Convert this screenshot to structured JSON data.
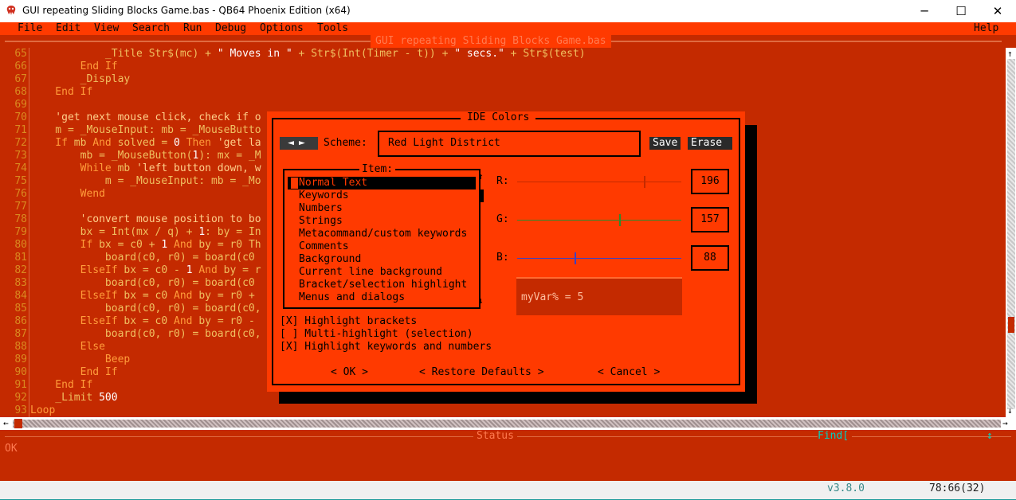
{
  "window": {
    "title": "GUI repeating Sliding Blocks Game.bas - QB64 Phoenix Edition (x64)",
    "minimize": "─",
    "maximize": "☐",
    "close": "✕"
  },
  "menu": {
    "file": "File",
    "edit": "Edit",
    "view": "View",
    "search": "Search",
    "run": "Run",
    "debug": "Debug",
    "options": "Options",
    "tools": "Tools",
    "help": "Help"
  },
  "editor": {
    "filename": "GUI repeating Sliding Blocks Game.bas",
    "line_numbers": [
      "65",
      "66",
      "67",
      "68",
      "69",
      "70",
      "71",
      "72",
      "73",
      "74",
      "75",
      "76",
      "77",
      "78",
      "79",
      "80",
      "81",
      "82",
      "83",
      "84",
      "85",
      "86",
      "87",
      "88",
      "89",
      "90",
      "91",
      "92",
      "93"
    ],
    "lines": [
      [
        {
          "c": "t",
          "s": "            _Title Str$(mc) + "
        },
        {
          "c": "n",
          "s": "\" Moves in \""
        },
        {
          "c": "t",
          "s": " + Str$(Int(Timer - t)) + "
        },
        {
          "c": "n",
          "s": "\" secs.\""
        },
        {
          "c": "t",
          "s": " + Str$(test)"
        }
      ],
      [
        {
          "c": "k",
          "s": "        End If"
        }
      ],
      [
        {
          "c": "t",
          "s": "        _Display"
        }
      ],
      [
        {
          "c": "k",
          "s": "    End If"
        }
      ],
      [
        {
          "c": "t",
          "s": ""
        }
      ],
      [
        {
          "c": "cm",
          "s": "    'get next mouse click, check if o"
        }
      ],
      [
        {
          "c": "t",
          "s": "    m = _MouseInput: mb = _MouseButto"
        }
      ],
      [
        {
          "c": "k",
          "s": "    If "
        },
        {
          "c": "t",
          "s": "mb "
        },
        {
          "c": "k",
          "s": "And "
        },
        {
          "c": "t",
          "s": "solved = "
        },
        {
          "c": "n",
          "s": "0"
        },
        {
          "c": "k",
          "s": " Then "
        },
        {
          "c": "cm",
          "s": "'get la"
        }
      ],
      [
        {
          "c": "t",
          "s": "        mb = _MouseButton("
        },
        {
          "c": "n",
          "s": "1"
        },
        {
          "c": "t",
          "s": "): mx = _M"
        }
      ],
      [
        {
          "c": "k",
          "s": "        While "
        },
        {
          "c": "t",
          "s": "mb "
        },
        {
          "c": "cm",
          "s": "'left button down, w"
        }
      ],
      [
        {
          "c": "t",
          "s": "            m = _MouseInput: mb = _Mo"
        }
      ],
      [
        {
          "c": "k",
          "s": "        Wend"
        }
      ],
      [
        {
          "c": "t",
          "s": ""
        }
      ],
      [
        {
          "c": "cm",
          "s": "        'convert mouse position to bo"
        }
      ],
      [
        {
          "c": "t",
          "s": "        bx = Int(mx / q) + "
        },
        {
          "c": "n",
          "s": "1"
        },
        {
          "c": "t",
          "s": ": by = In"
        }
      ],
      [
        {
          "c": "k",
          "s": "        If "
        },
        {
          "c": "t",
          "s": "bx = c0 + "
        },
        {
          "c": "n",
          "s": "1"
        },
        {
          "c": "k",
          "s": " And "
        },
        {
          "c": "t",
          "s": "by = r0 Th"
        }
      ],
      [
        {
          "c": "t",
          "s": "            board(c0, r0) = board(c0"
        }
      ],
      [
        {
          "c": "k",
          "s": "        ElseIf "
        },
        {
          "c": "t",
          "s": "bx = c0 - "
        },
        {
          "c": "n",
          "s": "1"
        },
        {
          "c": "k",
          "s": " And "
        },
        {
          "c": "t",
          "s": "by = r"
        }
      ],
      [
        {
          "c": "t",
          "s": "            board(c0, r0) = board(c0"
        }
      ],
      [
        {
          "c": "k",
          "s": "        ElseIf "
        },
        {
          "c": "t",
          "s": "bx = c0 "
        },
        {
          "c": "k",
          "s": "And "
        },
        {
          "c": "t",
          "s": "by = r0 +"
        }
      ],
      [
        {
          "c": "t",
          "s": "            board(c0, r0) = board(c0,"
        }
      ],
      [
        {
          "c": "k",
          "s": "        ElseIf "
        },
        {
          "c": "t",
          "s": "bx = c0 "
        },
        {
          "c": "k",
          "s": "And "
        },
        {
          "c": "t",
          "s": "by = r0 -"
        }
      ],
      [
        {
          "c": "t",
          "s": "            board(c0, r0) = board(c0,"
        }
      ],
      [
        {
          "c": "k",
          "s": "        Else"
        }
      ],
      [
        {
          "c": "k",
          "s": "            Beep"
        }
      ],
      [
        {
          "c": "k",
          "s": "        End If"
        }
      ],
      [
        {
          "c": "k",
          "s": "    End If"
        }
      ],
      [
        {
          "c": "t",
          "s": "    _Limit "
        },
        {
          "c": "n",
          "s": "500"
        }
      ],
      [
        {
          "c": "k",
          "s": "Loop"
        }
      ]
    ]
  },
  "scroll": {
    "up": "↑",
    "down": "↓",
    "left": "←",
    "right": "→"
  },
  "status": {
    "label": "Status",
    "find": "Find[",
    "find_arrows": "↕",
    "message": "OK",
    "version": "v3.8.0",
    "cursor_pos": "78:66(32)"
  },
  "dialog": {
    "title": "IDE Colors",
    "scheme_label": "Scheme:",
    "scheme_value": "Red Light District",
    "save": "Save",
    "erase": "Erase",
    "item_label": "Item:",
    "items": [
      "Normal Text",
      "Keywords",
      "Numbers",
      "Strings",
      "Metacommand/custom keywords",
      "Comments",
      "Background",
      "Current line background",
      "Bracket/selection highlight",
      "Menus and dialogs"
    ],
    "selected_item": 0,
    "r_label": "R:",
    "g_label": "G:",
    "b_label": "B:",
    "r_value": "196",
    "g_value": "157",
    "b_value": "88",
    "r_level": 0.77,
    "g_level": 0.62,
    "b_level": 0.35,
    "r_color": "#c42a00",
    "g_color": "#2e8b2e",
    "b_color": "#4040c0",
    "watch_text": "myVar% = 5",
    "check1": "[X] Highlight brackets",
    "check2": "[ ] Multi-highlight (selection)",
    "check3": "[X] Highlight keywords and numbers",
    "ok": "< OK >",
    "restore": "< Restore Defaults >",
    "cancel": "< Cancel >"
  }
}
